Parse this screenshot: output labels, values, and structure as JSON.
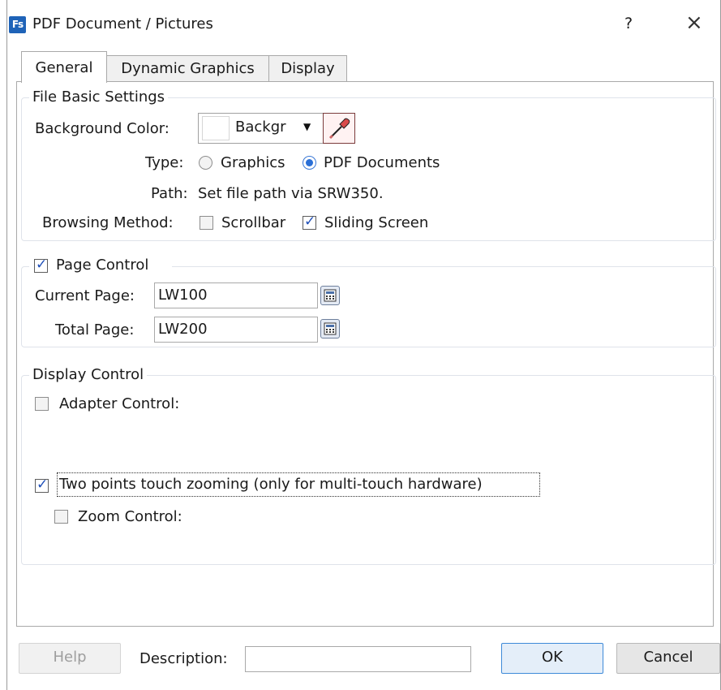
{
  "window": {
    "title": "PDF Document / Pictures",
    "icon_text": "Fs",
    "help_glyph": "?",
    "close_glyph": "×",
    "icon": "app-icon"
  },
  "tabs": [
    {
      "label": "General",
      "active": true
    },
    {
      "label": "Dynamic Graphics",
      "active": false
    },
    {
      "label": "Display",
      "active": false
    }
  ],
  "file_basic": {
    "group_label": "File Basic Settings",
    "bg_color_label": "Background Color:",
    "bg_color_value": "Backgr",
    "bg_color_swatch": "#ffffff",
    "type_label": "Type:",
    "type_options": [
      {
        "label": "Graphics",
        "selected": false
      },
      {
        "label": "PDF Documents",
        "selected": true
      }
    ],
    "path_label": "Path:",
    "path_value": "Set file path via SRW350.",
    "browse_label": "Browsing Method:",
    "browse_options": [
      {
        "label": "Scrollbar",
        "checked": false
      },
      {
        "label": "Sliding Screen",
        "checked": true
      }
    ]
  },
  "page_control": {
    "label": "Page Control",
    "checked": true,
    "current_label": "Current Page:",
    "current_value": "LW100",
    "total_label": "Total Page:",
    "total_value": "LW200"
  },
  "display_control": {
    "group_label": "Display Control",
    "adapter_label": "Adapter Control:",
    "adapter_checked": false,
    "two_point_label": "Two points touch zooming (only for multi-touch hardware)",
    "two_point_checked": true,
    "zoom_label": "Zoom Control:",
    "zoom_checked": false
  },
  "footer": {
    "help_label": "Help",
    "description_label": "Description:",
    "description_value": "",
    "ok_label": "OK",
    "cancel_label": "Cancel"
  },
  "colors": {
    "accent": "#2a6fd6",
    "check": "#1f4fb8",
    "window_border": "#9a9a9a"
  }
}
